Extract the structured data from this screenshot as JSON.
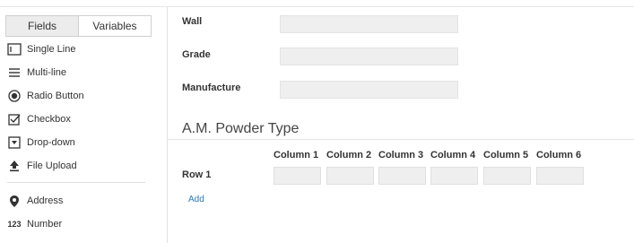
{
  "tabs": [
    "Fields",
    "Variables"
  ],
  "field_types": [
    {
      "label": "Single Line",
      "icon": "single-line-icon"
    },
    {
      "label": "Multi-line",
      "icon": "multi-line-icon"
    },
    {
      "label": "Radio Button",
      "icon": "radio-button-icon"
    },
    {
      "label": "Checkbox",
      "icon": "checkbox-icon"
    },
    {
      "label": "Drop-down",
      "icon": "dropdown-icon"
    },
    {
      "label": "File Upload",
      "icon": "file-upload-icon"
    }
  ],
  "field_types_2": [
    {
      "label": "Address",
      "icon": "location-pin-icon"
    },
    {
      "label": "Number",
      "icon": "number-icon"
    }
  ],
  "form": {
    "fields": [
      {
        "label": "Wall",
        "value": ""
      },
      {
        "label": "Grade",
        "value": ""
      },
      {
        "label": "Manufacture",
        "value": ""
      }
    ],
    "section_title": "A.M. Powder Type",
    "columns": [
      "Column 1",
      "Column 2",
      "Column 3",
      "Column 4",
      "Column 5",
      "Column 6"
    ],
    "rows": [
      "Row 1"
    ],
    "add_label": "Add"
  },
  "colors": {
    "link": "#2a7ab8",
    "input_bg": "#efefef",
    "tab_active_bg": "#ececec"
  }
}
